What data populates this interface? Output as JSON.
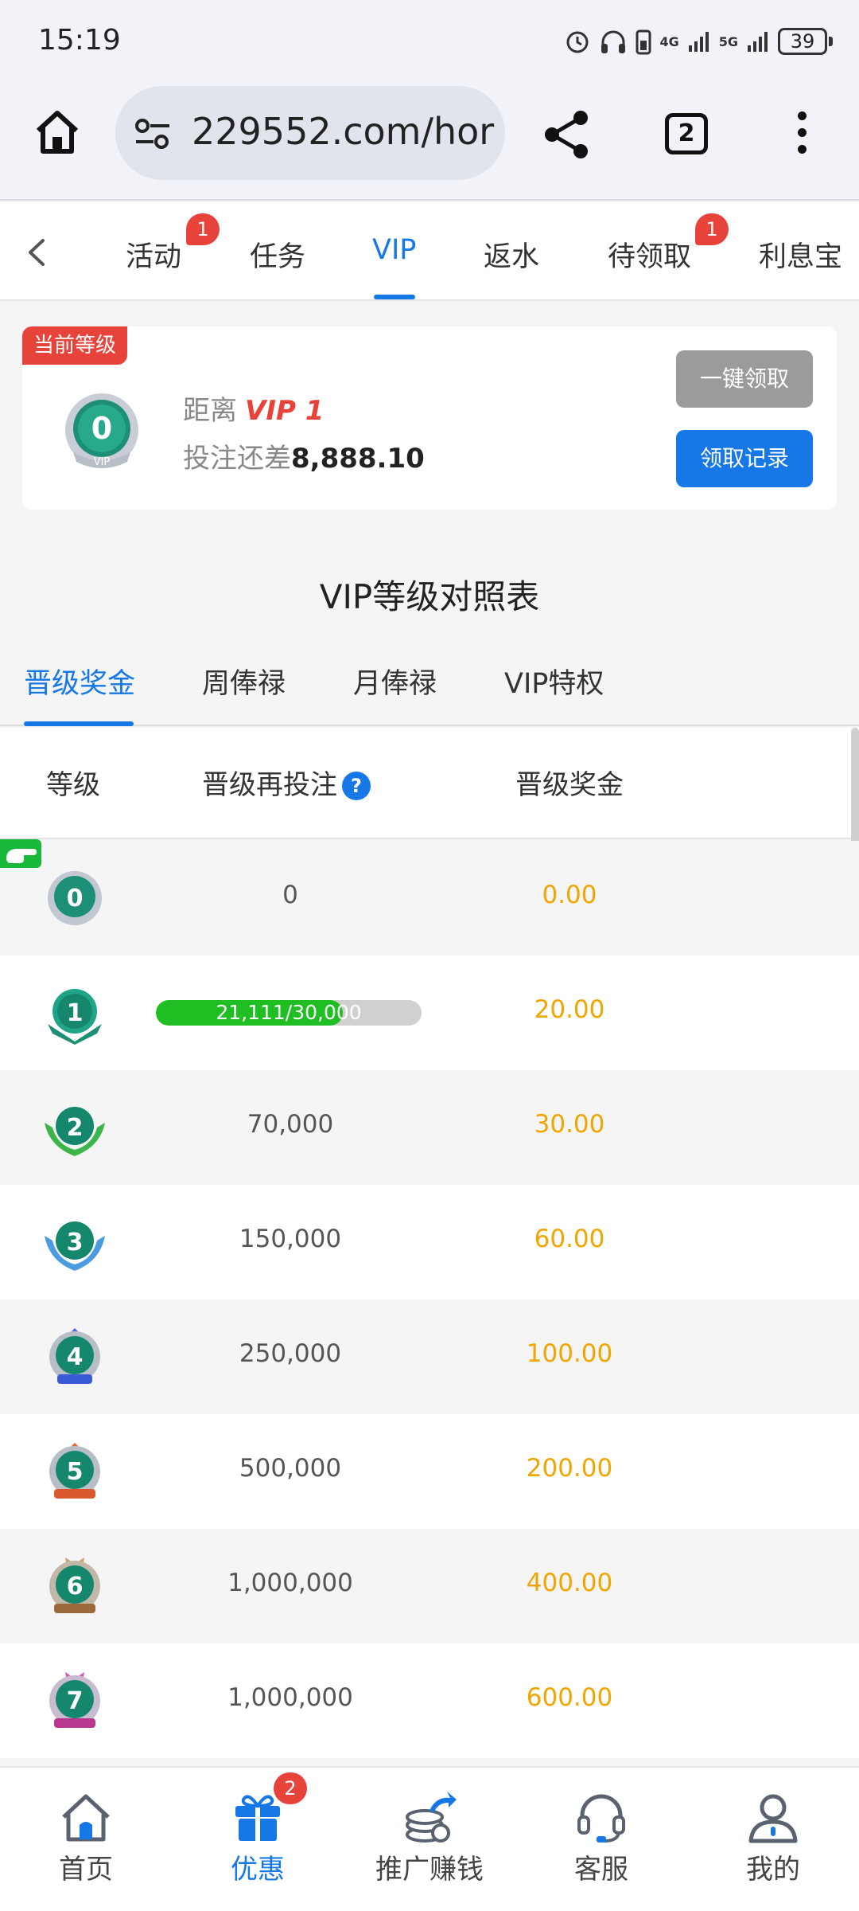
{
  "status": {
    "time": "15:19",
    "battery": "39",
    "net1": "4G",
    "net2": "5G"
  },
  "browser": {
    "url": "229552.com/hor",
    "tab_count": "2"
  },
  "category_tabs": [
    {
      "label": "活动",
      "badge": "1"
    },
    {
      "label": "任务"
    },
    {
      "label": "VIP",
      "active": true
    },
    {
      "label": "返水"
    },
    {
      "label": "待领取",
      "badge": "1"
    },
    {
      "label": "利息宝"
    }
  ],
  "current": {
    "tag": "当前等级",
    "level": "0",
    "distance_label": "距离",
    "next_vip": "VIP 1",
    "bet_label": "投注还差",
    "bet_remaining": "8,888.10",
    "claim_button": "一键领取",
    "record_button": "领取记录"
  },
  "section_title": "VIP等级对照表",
  "sub_tabs": [
    {
      "label": "晋级奖金",
      "active": true
    },
    {
      "label": "周俸禄"
    },
    {
      "label": "月俸禄"
    },
    {
      "label": "VIP特权"
    }
  ],
  "table": {
    "headers": {
      "level": "等级",
      "bet": "晋级再投注",
      "bonus": "晋级奖金"
    },
    "rows": [
      {
        "level": "0",
        "bet": "0",
        "bonus": "0.00"
      },
      {
        "level": "1",
        "progress_text": "21,111/30,000",
        "progress": 0.7037,
        "bonus": "20.00"
      },
      {
        "level": "2",
        "bet": "70,000",
        "bonus": "30.00"
      },
      {
        "level": "3",
        "bet": "150,000",
        "bonus": "60.00"
      },
      {
        "level": "4",
        "bet": "250,000",
        "bonus": "100.00"
      },
      {
        "level": "5",
        "bet": "500,000",
        "bonus": "200.00"
      },
      {
        "level": "6",
        "bet": "1,000,000",
        "bonus": "400.00"
      },
      {
        "level": "7",
        "bet": "1,000,000",
        "bonus": "600.00"
      }
    ]
  },
  "bottom_nav": [
    {
      "label": "首页",
      "icon": "home-icon"
    },
    {
      "label": "优惠",
      "icon": "gift-icon",
      "badge": "2",
      "active": true
    },
    {
      "label": "推广赚钱",
      "icon": "promote-icon"
    },
    {
      "label": "客服",
      "icon": "headset-icon"
    },
    {
      "label": "我的",
      "icon": "user-icon"
    }
  ],
  "colors": {
    "accent": "#1677e6",
    "badge": "#e8433b",
    "bonus": "#f0a500",
    "progress": "#1fbe22"
  }
}
